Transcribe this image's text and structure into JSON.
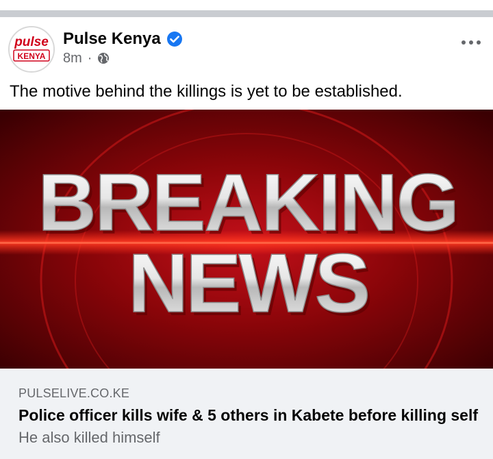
{
  "post": {
    "page_name": "Pulse Kenya",
    "verified": true,
    "timestamp": "8m",
    "separator": "·",
    "audience_icon": "globe-icon",
    "more_icon": "more-horizontal-icon",
    "caption": "The motive behind the killings is yet to be established."
  },
  "avatar": {
    "logo_word": "pulse",
    "logo_country": "KENYA"
  },
  "image": {
    "line1": "BREAKING",
    "line2": "NEWS"
  },
  "link": {
    "domain": "PULSELIVE.CO.KE",
    "title": "Police officer kills wife & 5 others in Kabete before killing self",
    "description": "He also killed himself"
  },
  "colors": {
    "verified_blue": "#1877f2",
    "secondary_text": "#65676b",
    "preview_bg": "#f0f2f5",
    "brand_red": "#d0021b"
  }
}
